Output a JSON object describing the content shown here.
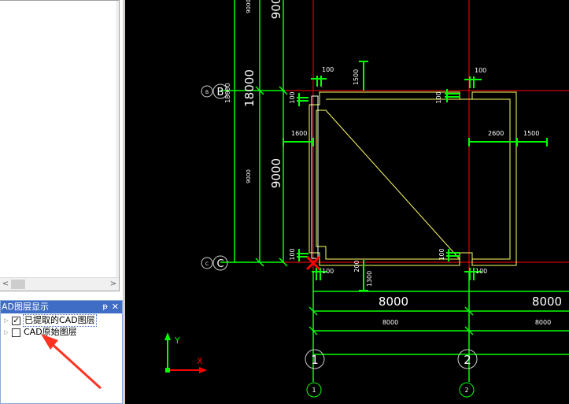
{
  "left_panel": {
    "scroll_left": "<",
    "scroll_right": ">",
    "layer_panel": {
      "title": "AD图层显示",
      "pin": "ᵽ",
      "close": "✕",
      "items": [
        {
          "label": "已提取的CAD图层",
          "checked": "✓"
        },
        {
          "label": "CAD原始图层",
          "checked": ""
        }
      ]
    }
  },
  "cad": {
    "grid_labels": {
      "row_b": "B",
      "row_c": "C",
      "col_1": "1",
      "col_2": "2",
      "row_b_small": "B",
      "row_c_small": "C",
      "col_1_small": "1",
      "col_2_small": "2"
    },
    "dims": {
      "d9000_top_small": "9000",
      "d9000_top_big": "900",
      "d18000_small": "18000",
      "d18000_big": "18000",
      "d9000_mid_small": "9000",
      "d9000_mid_big": "9000",
      "d100_a": "100",
      "d100_b": "100",
      "d100_c": "100",
      "d100_d": "100",
      "d100_e": "100",
      "d100_f": "100",
      "d100_g": "100",
      "d100_h": "100",
      "d1500_v": "1500",
      "d1600": "1600",
      "d2600": "2600",
      "d1500_h": "1500",
      "d200": "200",
      "d1300": "1300",
      "d8000_big_a": "8000",
      "d8000_big_b": "8000",
      "d8000_small_a": "8000",
      "d8000_small_b": "8000"
    },
    "ucs": {
      "x_label": "X",
      "y_label": "Y"
    },
    "colors": {
      "grid_green": "#00ff00",
      "axis_red": "#ff0000",
      "wall_yellow": "#ffff66",
      "background": "#000000"
    }
  }
}
